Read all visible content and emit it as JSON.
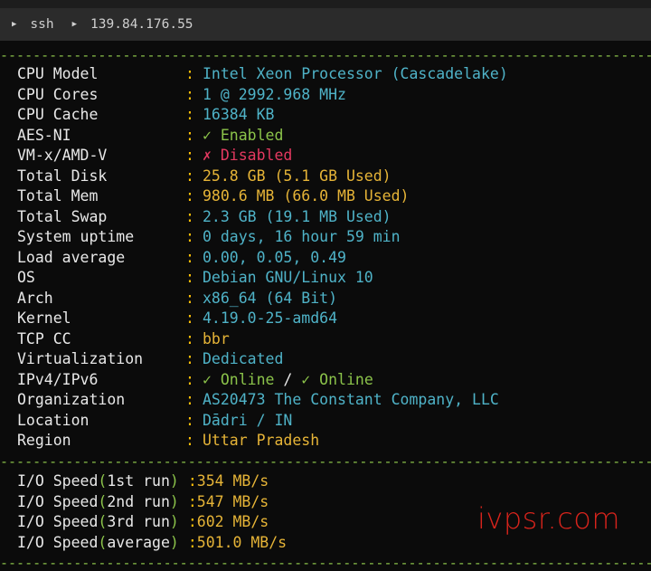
{
  "tab": {
    "label1": "ssh",
    "label2": "139.84.176.55"
  },
  "separator": "------------------------------------------------------------------------------------------------------------------------",
  "rows": [
    {
      "label": "CPU Model",
      "value": "Intel Xeon Processor (Cascadelake)"
    },
    {
      "label": "CPU Cores",
      "value": "1 @ 2992.968 MHz"
    },
    {
      "label": "CPU Cache",
      "value": "16384 KB"
    },
    {
      "label": "AES-NI",
      "value": "✓ Enabled"
    },
    {
      "label": "VM-x/AMD-V",
      "value": "✗ Disabled"
    },
    {
      "label": "Total Disk",
      "value": "25.8 GB (5.1 GB Used)"
    },
    {
      "label": "Total Mem",
      "value": "980.6 MB (66.0 MB Used)"
    },
    {
      "label": "Total Swap",
      "value": "2.3 GB (19.1 MB Used)"
    },
    {
      "label": "System uptime",
      "value": "0 days, 16 hour 59 min"
    },
    {
      "label": "Load average",
      "value": "0.00, 0.05, 0.49"
    },
    {
      "label": "OS",
      "value": "Debian GNU/Linux 10"
    },
    {
      "label": "Arch",
      "value": "x86_64 (64 Bit)"
    },
    {
      "label": "Kernel",
      "value": "4.19.0-25-amd64"
    },
    {
      "label": "TCP CC",
      "value": "bbr"
    },
    {
      "label": "Virtualization",
      "value": "Dedicated"
    },
    {
      "label": "IPv4/IPv6",
      "value_a": "✓ Online",
      "slash": " / ",
      "value_b": "✓ Online"
    },
    {
      "label": "Organization",
      "value": "AS20473 The Constant Company, LLC"
    },
    {
      "label": "Location",
      "value": "Dādri / IN"
    },
    {
      "label": "Region",
      "value": "Uttar Pradesh"
    }
  ],
  "io": [
    {
      "prefix": "I/O Speed",
      "paren_open": "(",
      "run": "1st run",
      "paren_close": ")",
      "value": "354 MB/s"
    },
    {
      "prefix": "I/O Speed",
      "paren_open": "(",
      "run": "2nd run",
      "paren_close": ")",
      "value": "547 MB/s"
    },
    {
      "prefix": "I/O Speed",
      "paren_open": "(",
      "run": "3rd run",
      "paren_close": ")",
      "value": "602 MB/s"
    },
    {
      "prefix": "I/O Speed",
      "paren_open": "(",
      "run": "average",
      "paren_close": ")",
      "value": "501.0 MB/s"
    }
  ],
  "colon": ":",
  "watermark": "ivpsr.com",
  "colors": {
    "cyan": "#4fb3c8",
    "yellow": "#e6b437",
    "green": "#8bc34a",
    "red": "#e53960",
    "watermark": "#d8241c"
  }
}
